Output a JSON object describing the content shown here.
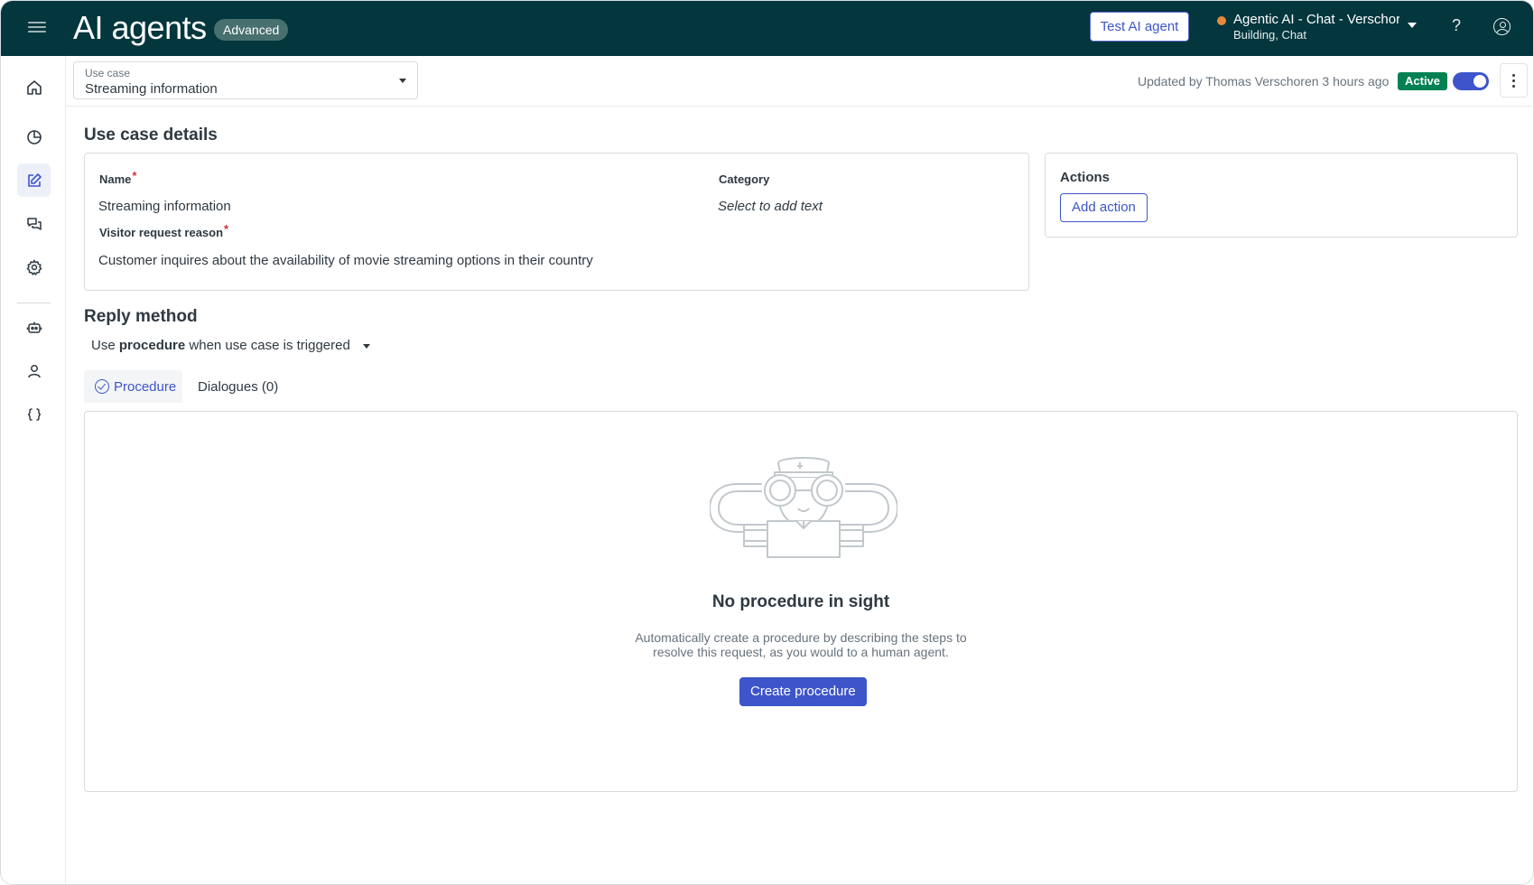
{
  "header": {
    "title": "AI agents",
    "badge": "Advanced",
    "test_button": "Test AI agent",
    "agent_name": "Agentic AI - Chat - Verschoren",
    "agent_sub": "Building, Chat",
    "help_glyph": "?",
    "status_dot_color": "#e58a3c",
    "bg_color": "#03363d"
  },
  "nav": {
    "items": [
      {
        "icon": "home-icon"
      },
      {
        "icon": "pie-chart-icon"
      },
      {
        "icon": "edit-icon"
      },
      {
        "icon": "chat-bubbles-icon"
      },
      {
        "icon": "gear-icon"
      },
      {
        "icon": "robot-icon"
      },
      {
        "icon": "person-icon"
      },
      {
        "icon": "braces-icon"
      }
    ]
  },
  "subheader": {
    "usecase_label": "Use case",
    "usecase_value": "Streaming information",
    "updated": "Updated by Thomas Verschoren 3 hours ago",
    "status": "Active",
    "toggle_on": true
  },
  "details": {
    "title": "Use case details",
    "name_label": "Name",
    "name_value": "Streaming information",
    "category_label": "Category",
    "category_placeholder": "Select to add text",
    "reason_label": "Visitor request reason",
    "reason_value": "Customer inquires about the availability of movie streaming options in their country",
    "required_mark": "*"
  },
  "actions": {
    "title": "Actions",
    "add_button": "Add action"
  },
  "reply": {
    "title": "Reply method",
    "prefix": "Use",
    "method": "procedure",
    "suffix": "when use case is triggered",
    "tabs": [
      {
        "label": "Procedure",
        "selected": true
      },
      {
        "label": "Dialogues (0)",
        "selected": false
      }
    ]
  },
  "empty_state": {
    "title": "No procedure in sight",
    "desc_line1": "Automatically create a procedure by describing the steps to",
    "desc_line2": "resolve this request, as you would to a human agent.",
    "button": "Create procedure"
  },
  "colors": {
    "accent": "#3d55c9",
    "active_badge": "#038153"
  }
}
